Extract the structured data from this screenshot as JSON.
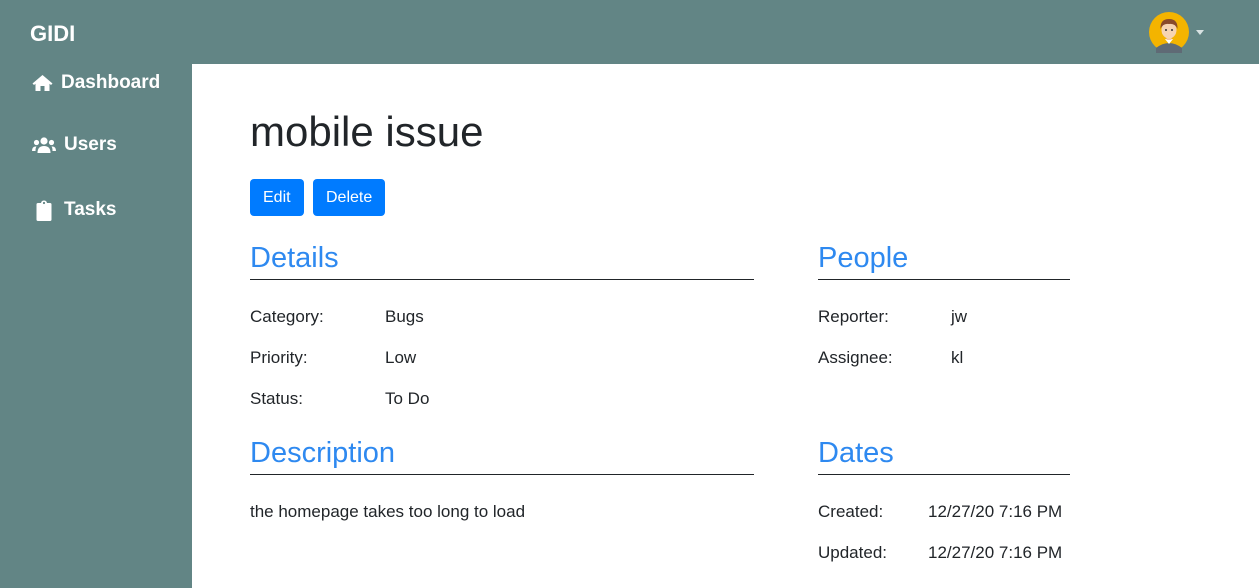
{
  "app": {
    "brand": "GIDI"
  },
  "sidebar": {
    "items": [
      {
        "label": "Dashboard",
        "icon": "home-icon"
      },
      {
        "label": "Users",
        "icon": "users-icon"
      },
      {
        "label": "Tasks",
        "icon": "clipboard-icon"
      }
    ]
  },
  "task": {
    "title": "mobile issue",
    "actions": {
      "edit": "Edit",
      "delete": "Delete"
    }
  },
  "details": {
    "heading": "Details",
    "rows": [
      {
        "label": "Category:",
        "value": "Bugs"
      },
      {
        "label": "Priority:",
        "value": "Low"
      },
      {
        "label": "Status:",
        "value": "To Do"
      }
    ]
  },
  "people": {
    "heading": "People",
    "rows": [
      {
        "label": "Reporter:",
        "value": "jw"
      },
      {
        "label": "Assignee:",
        "value": "kl"
      }
    ]
  },
  "description": {
    "heading": "Description",
    "text": "the homepage takes too long to load"
  },
  "dates": {
    "heading": "Dates",
    "rows": [
      {
        "label": "Created:",
        "value": "12/27/20 7:16 PM"
      },
      {
        "label": "Updated:",
        "value": "12/27/20 7:16 PM"
      }
    ]
  },
  "colors": {
    "navbar": "#628585",
    "primary_button": "#007bff",
    "section_heading": "#2e89f0"
  }
}
